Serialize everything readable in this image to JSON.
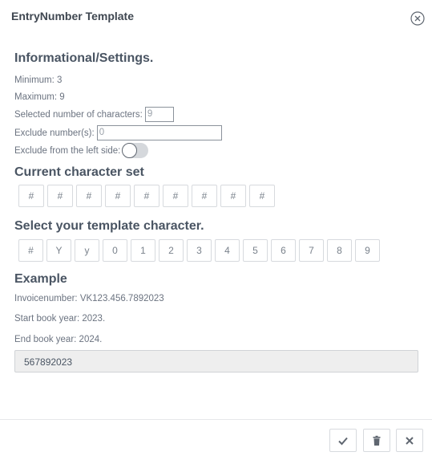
{
  "window": {
    "title": "EntryNumber Template"
  },
  "info": {
    "heading": "Informational/Settings.",
    "minimum": "Minimum: 3",
    "maximum": "Maximum: 9",
    "selected_label": "Selected number of characters:",
    "selected_value": "9",
    "exclude_numbers_label": "Exclude number(s):",
    "exclude_numbers_value": "0",
    "exclude_left_label": "Exclude from the left side:",
    "exclude_left_on": false
  },
  "current_set": {
    "heading": "Current character set",
    "chars": [
      "#",
      "#",
      "#",
      "#",
      "#",
      "#",
      "#",
      "#",
      "#"
    ]
  },
  "template_chars": {
    "heading": "Select your template character.",
    "chars": [
      "#",
      "Y",
      "y",
      "0",
      "1",
      "2",
      "3",
      "4",
      "5",
      "6",
      "7",
      "8",
      "9"
    ]
  },
  "example": {
    "heading": "Example",
    "invoice": "Invoicenumber: VK123.456.7892023",
    "start": "Start book year: 2023.",
    "end": "End book year: 2024.",
    "output": "567892023"
  },
  "footer": {
    "confirm_icon": "check-icon",
    "delete_icon": "trash-icon",
    "cancel_icon": "close-icon"
  }
}
